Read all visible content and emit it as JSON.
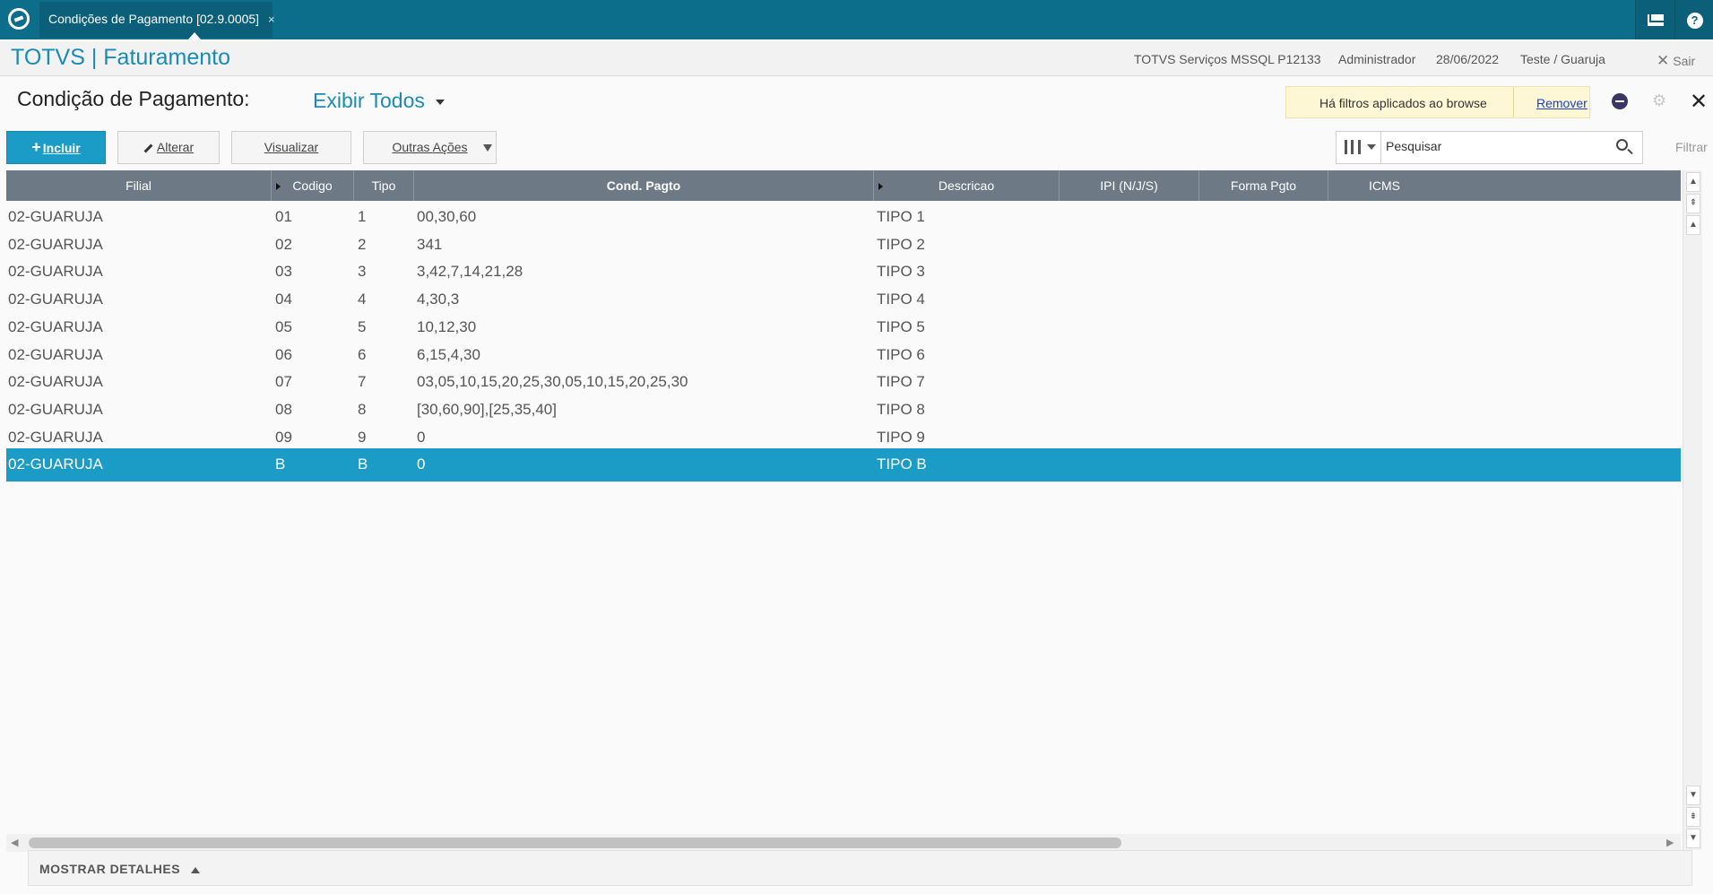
{
  "tab": {
    "title": "Condições de Pagamento [02.9.0005]",
    "close": "×"
  },
  "header": {
    "app_title": "TOTVS | Faturamento",
    "server": "TOTVS Serviços MSSQL P12133",
    "user": "Administrador",
    "date": "28/06/2022",
    "environment": "Teste / Guaruja",
    "exit_label": "Sair"
  },
  "page": {
    "title": "Condição de Pagamento:",
    "view_filter": "Exibir Todos"
  },
  "filter_notice": {
    "text": "Há filtros aplicados ao browse",
    "remove_label": "Remover"
  },
  "toolbar": {
    "add_label": "Incluir",
    "edit_label": "Alterar",
    "view_label": "Visualizar",
    "more_label": "Outras Ações"
  },
  "search": {
    "placeholder": "Pesquisar",
    "filter_label": "Filtrar"
  },
  "grid": {
    "columns": [
      "Filial",
      "Codigo",
      "Tipo",
      "Cond. Pagto",
      "Descricao",
      "IPI (N/J/S)",
      "Forma Pgto",
      "ICMS"
    ],
    "rows": [
      {
        "filial": "02-GUARUJA",
        "codigo": "01",
        "tipo": "1",
        "cond": "00,30,60",
        "descricao": "TIPO 1"
      },
      {
        "filial": "02-GUARUJA",
        "codigo": "02",
        "tipo": "2",
        "cond": "341",
        "descricao": "TIPO 2"
      },
      {
        "filial": "02-GUARUJA",
        "codigo": "03",
        "tipo": "3",
        "cond": "3,42,7,14,21,28",
        "descricao": "TIPO 3"
      },
      {
        "filial": "02-GUARUJA",
        "codigo": "04",
        "tipo": "4",
        "cond": "4,30,3",
        "descricao": "TIPO 4"
      },
      {
        "filial": "02-GUARUJA",
        "codigo": "05",
        "tipo": "5",
        "cond": "10,12,30",
        "descricao": "TIPO 5"
      },
      {
        "filial": "02-GUARUJA",
        "codigo": "06",
        "tipo": "6",
        "cond": "6,15,4,30",
        "descricao": "TIPO 6"
      },
      {
        "filial": "02-GUARUJA",
        "codigo": "07",
        "tipo": "7",
        "cond": "03,05,10,15,20,25,30,05,10,15,20,25,30",
        "descricao": "TIPO 7"
      },
      {
        "filial": "02-GUARUJA",
        "codigo": "08",
        "tipo": "8",
        "cond": "[30,60,90],[25,35,40]",
        "descricao": "TIPO 8"
      },
      {
        "filial": "02-GUARUJA",
        "codigo": "09",
        "tipo": "9",
        "cond": "0",
        "descricao": "TIPO 9"
      },
      {
        "filial": "02-GUARUJA",
        "codigo": "B",
        "tipo": "B",
        "cond": "0",
        "descricao": "TIPO B",
        "selected": true
      }
    ]
  },
  "details": {
    "label": "MOSTRAR DETALHES"
  },
  "colors": {
    "topbar": "#0d6e8c",
    "accent": "#1a9cc7",
    "grid_header": "#6d7a85",
    "notice_bg": "#fdf7d5"
  },
  "icons": [
    "logo-icon",
    "mail-icon",
    "help-icon",
    "close-icon",
    "gear-icon",
    "search-icon",
    "columns-icon"
  ]
}
